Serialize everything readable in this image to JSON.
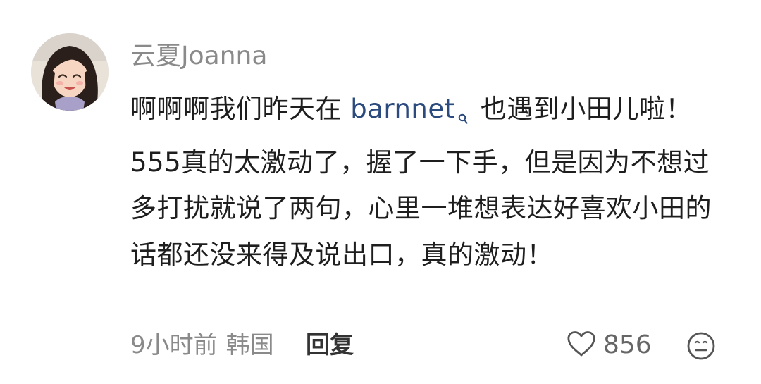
{
  "comment": {
    "username": "云夏Joanna",
    "text_before_mention": "啊啊啊我们昨天在 ",
    "mention": "barnnet",
    "text_after_mention": " 也遇到小田儿啦！555真的太激动了，握了一下手，但是因为不想过多打扰就说了两句，心里一堆想表达好喜欢小田的话都还没来得及说出口，真的激动！",
    "time": "9小时前",
    "location": "韩国",
    "reply_label": "回复",
    "like_count": "856"
  },
  "icons": {
    "mention": "search-icon",
    "like": "heart-outline-icon",
    "reaction": "neutral-face-icon"
  },
  "colors": {
    "username": "#8a8a8a",
    "body_text": "#1e1e1e",
    "mention": "#2b4a7d",
    "meta": "#8a8a8a"
  }
}
